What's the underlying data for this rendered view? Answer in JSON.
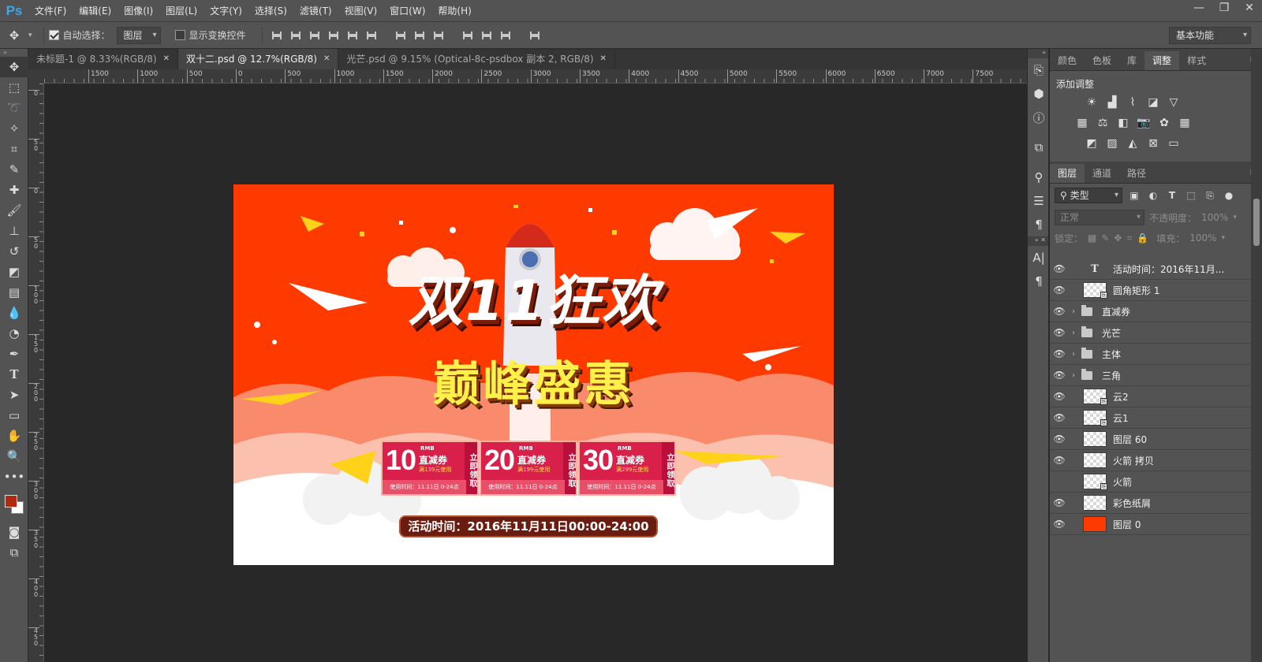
{
  "app": {
    "logo": "Ps"
  },
  "menu": [
    "文件(F)",
    "编辑(E)",
    "图像(I)",
    "图层(L)",
    "文字(Y)",
    "选择(S)",
    "滤镜(T)",
    "视图(V)",
    "窗口(W)",
    "帮助(H)"
  ],
  "window_controls": [
    "—",
    "❐",
    "✕"
  ],
  "options": {
    "auto_select_label": "自动选择：",
    "auto_select_checked": true,
    "auto_select_target": "图层",
    "show_transform_label": "显示变换控件",
    "show_transform_checked": false,
    "workspace": "基本功能"
  },
  "tabs": [
    {
      "label": "未标题-1 @ 8.33%(RGB/8)",
      "active": false
    },
    {
      "label": "双十二.psd @ 12.7%(RGB/8)",
      "active": true
    },
    {
      "label": "光芒.psd @ 9.15% (Optical-8c-psdbox 副本 2, RGB/8)",
      "active": false
    }
  ],
  "ruler_h": [
    "1500",
    "1000",
    "500",
    "0",
    "500",
    "1000",
    "1500",
    "2000",
    "2500",
    "3000",
    "3500",
    "4000",
    "4500",
    "5000",
    "5500",
    "6000",
    "6500",
    "7000",
    "7500"
  ],
  "ruler_v": [
    "0",
    "50",
    "0",
    "50",
    "100",
    "150",
    "200",
    "250",
    "300",
    "350",
    "400",
    "450"
  ],
  "panels": {
    "top_tabs": [
      "颜色",
      "色板",
      "库",
      "调整",
      "样式"
    ],
    "top_active": "调整",
    "adjust_title": "添加调整",
    "layer_tabs": [
      "图层",
      "通道",
      "路径"
    ],
    "layer_active": "图层",
    "filter_kind": "类型",
    "blend_mode": "正常",
    "opacity_label": "不透明度：",
    "opacity_value": "100%",
    "lock_label": "锁定：",
    "fill_label": "填充：",
    "fill_value": "100%"
  },
  "layers": [
    {
      "name": "活动时间：2016年11月...",
      "kind": "text",
      "visible": true
    },
    {
      "name": "圆角矩形 1",
      "kind": "shape",
      "visible": true
    },
    {
      "name": "直减券",
      "kind": "group",
      "visible": true
    },
    {
      "name": "光芒",
      "kind": "group",
      "visible": true
    },
    {
      "name": "主体",
      "kind": "group",
      "visible": true
    },
    {
      "name": "三角",
      "kind": "group",
      "visible": true
    },
    {
      "name": "云2",
      "kind": "smart",
      "visible": true
    },
    {
      "name": "云1",
      "kind": "smart",
      "visible": true
    },
    {
      "name": "图层 60",
      "kind": "pixel",
      "visible": true
    },
    {
      "name": "火箭 拷贝",
      "kind": "pixel",
      "visible": true
    },
    {
      "name": "火箭",
      "kind": "smart",
      "visible": false
    },
    {
      "name": "彩色纸屑",
      "kind": "pixel",
      "visible": true
    },
    {
      "name": "图层 0",
      "kind": "fill",
      "visible": true
    }
  ],
  "banner": {
    "title": "双11狂欢",
    "subtitle": "巅峰盛惠",
    "coupons": [
      {
        "amount": "10",
        "unit": "RMB",
        "type": "直减券",
        "condition": "满139元使用",
        "claim": "立即领取",
        "time": "使用时间：11.11日 0-24点"
      },
      {
        "amount": "20",
        "unit": "RMB",
        "type": "直减券",
        "condition": "满199元使用",
        "claim": "立即领取",
        "time": "使用时间：11.11日 0-24点"
      },
      {
        "amount": "30",
        "unit": "RMB",
        "type": "直减券",
        "condition": "满299元使用",
        "claim": "立即领取",
        "time": "使用时间：11.11日 0-24点"
      }
    ],
    "event_time": "活动时间：2016年11月11日00:00-24:00"
  },
  "colors": {
    "accent_red": "#ff3a00",
    "foreground": "#b02a10",
    "background": "#ffffff",
    "title_yellow": "#fff14a"
  }
}
